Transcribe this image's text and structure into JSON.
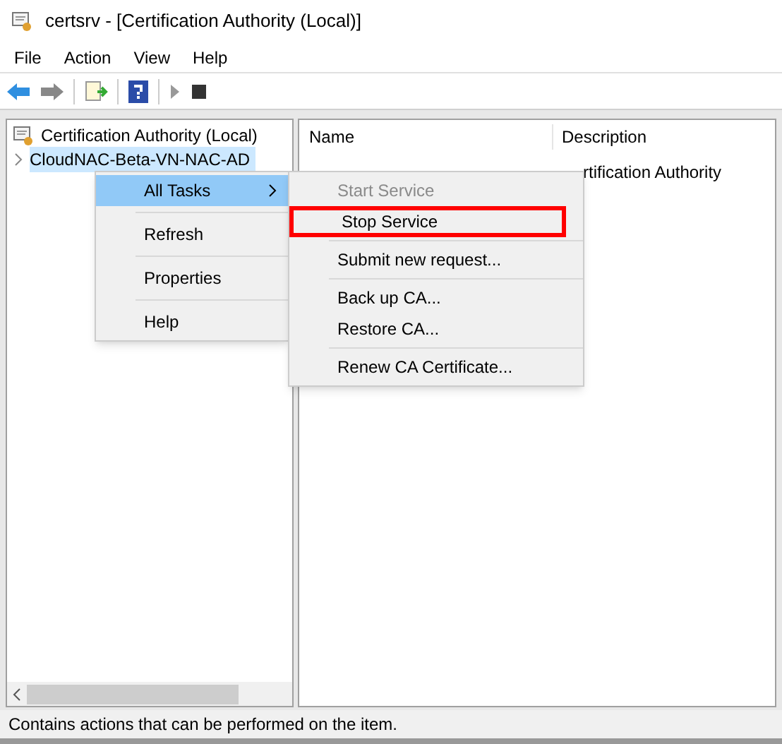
{
  "window": {
    "title": "certsrv - [Certification Authority (Local)]"
  },
  "menu_bar": [
    "File",
    "Action",
    "View",
    "Help"
  ],
  "tree": {
    "label": "Certification Authority (Local)",
    "children": [
      {
        "label": "CloudNAC-Beta-VN-NAC-AD",
        "selected": true,
        "expanded": false
      }
    ]
  },
  "list": {
    "columns": [
      "Name",
      "Description"
    ],
    "rows": [
      {
        "description": "rtification Authority"
      }
    ]
  },
  "context_menu": {
    "items": [
      {
        "label": "All Tasks",
        "kind": "submenu",
        "selected": true
      },
      {
        "label": "Refresh",
        "kind": "item",
        "selected": false
      },
      {
        "label": "Properties",
        "kind": "item",
        "selected": false
      },
      {
        "label": "Help",
        "kind": "item",
        "selected": false
      }
    ]
  },
  "submenu": {
    "groups": [
      [
        {
          "label": "Start Service",
          "disabled": true,
          "highlighted": false
        },
        {
          "label": "Stop Service",
          "disabled": false,
          "highlighted": true
        }
      ],
      [
        {
          "label": "Submit new request...",
          "disabled": false,
          "highlighted": false
        }
      ],
      [
        {
          "label": "Back up CA...",
          "disabled": false,
          "highlighted": false
        },
        {
          "label": "Restore CA...",
          "disabled": false,
          "highlighted": false
        }
      ],
      [
        {
          "label": "Renew CA Certificate...",
          "disabled": false,
          "highlighted": false
        }
      ]
    ]
  },
  "status_bar": "Contains actions that can be performed on the item."
}
